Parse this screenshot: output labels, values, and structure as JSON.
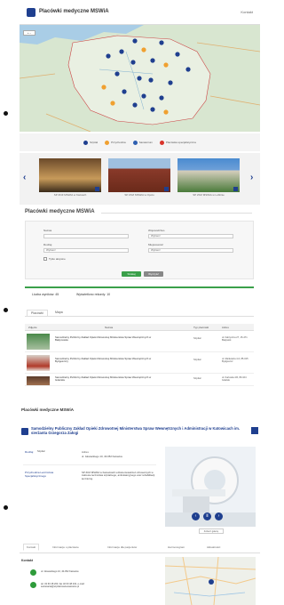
{
  "panel1": {
    "header": {
      "title": "Placówki medyczne MSWiA",
      "right_link": "Kontakt"
    },
    "map": {
      "zoom_control": "+ −"
    },
    "legend": [
      {
        "label": "Szpital",
        "color": "#1f3f8f"
      },
      {
        "label": "Przychodnia",
        "color": "#f0a030"
      },
      {
        "label": "Sanatorium",
        "color": "#2e5fb0"
      },
      {
        "label": "Placówka specjalistyczna",
        "color": "#d9342b"
      }
    ],
    "carousel": {
      "prev": "‹",
      "next": "›",
      "items": [
        {
          "caption": "SP ZOZ MSWiA w Kielcach"
        },
        {
          "caption": "SP ZOZ MSWiA w Opolu"
        },
        {
          "caption": "SP ZOZ MSWiA w Lublinie"
        }
      ]
    }
  },
  "panel2": {
    "title": "Placówki medyczne MSWiA",
    "filters": {
      "name_label": "Nazwa",
      "name_placeholder": "",
      "voivodeship_label": "Województwo",
      "voivodeship_value": "Wybierz",
      "type_label": "Rodzaj",
      "type_value": "Wybierz",
      "city_label": "Miejscowość",
      "city_value": "Wybierz",
      "checkbox_label": "Tylko aktywne",
      "search_button": "Szukaj",
      "clear_button": "Wyczyść"
    },
    "counts": {
      "all_label": "Liczba wyników: 45",
      "shown_label": "Wyświetlono rekordy: 10"
    },
    "tabs": [
      "Placówki",
      "Mapa"
    ],
    "table": {
      "headers": [
        "Zdjęcie",
        "Nazwa",
        "Typ placówki",
        "Adres"
      ],
      "rows": [
        {
          "name": "Samodzielny Publiczny Zakład Opieki Zdrowotnej Ministerstwa Spraw Wewnętrznych w Białymstoku",
          "type": "Szpital",
          "address": "ul. Fabryczna 27, 15-471 Białystok"
        },
        {
          "name": "Samodzielny Publiczny Zakład Opieki Zdrowotnej Ministerstwa Spraw Wewnętrznych w Bydgoszczy",
          "type": "Szpital",
          "address": "ul. Markwarta 4-6, 85-015 Bydgoszcz"
        },
        {
          "name": "Samodzielny Publiczny Zakład Opieki Zdrowotnej Ministerstwa Spraw Wewnętrznych w Gdańsku",
          "type": "Szpital",
          "address": "ul. Kartuska 4/6, 80-104 Gdańsk"
        }
      ]
    }
  },
  "panel3": {
    "top_title": "Placówki medyczne MSWiA",
    "heading": "Samodzielny Publiczny Zakład Opieki Zdrowotnej Ministerstwa Spraw Wewnętrznych i Administracji w Katowicach im. sierżanta Grzegorza Załogi",
    "info": {
      "type_label": "Rodzaj",
      "type_value": "Szpital",
      "address_label": "Adres",
      "address_text": "ul. Głowackiego 10, 40-052 Katowice",
      "desc_label": "Przychodnia Lecznictwa Specjalistycznego",
      "desc_text": "SP ZOZ MSWiA w Katowicach udziela świadczeń zdrowotnych w zakresie lecznictwa szpitalnego, ambulatoryjnego oraz rehabilitacji leczniczej."
    },
    "photo": {
      "prev": "‹",
      "pause": "Ⅱ",
      "next": "›",
      "gallery_button": "Zobacz galerię"
    },
    "tabs": [
      "Kontakt",
      "Informacje o placówce",
      "Informacje dla pacjentów",
      "Harmonogram",
      "Aktualności"
    ],
    "contact": {
      "title": "Kontakt",
      "address": "ul. Głowackiego 10, 40-052 Katowice",
      "phone": "tel. 32 60 48 200, fax 32 60 48 232, e-mail: sekretariat@szpitalmswia.katowice.pl"
    }
  }
}
